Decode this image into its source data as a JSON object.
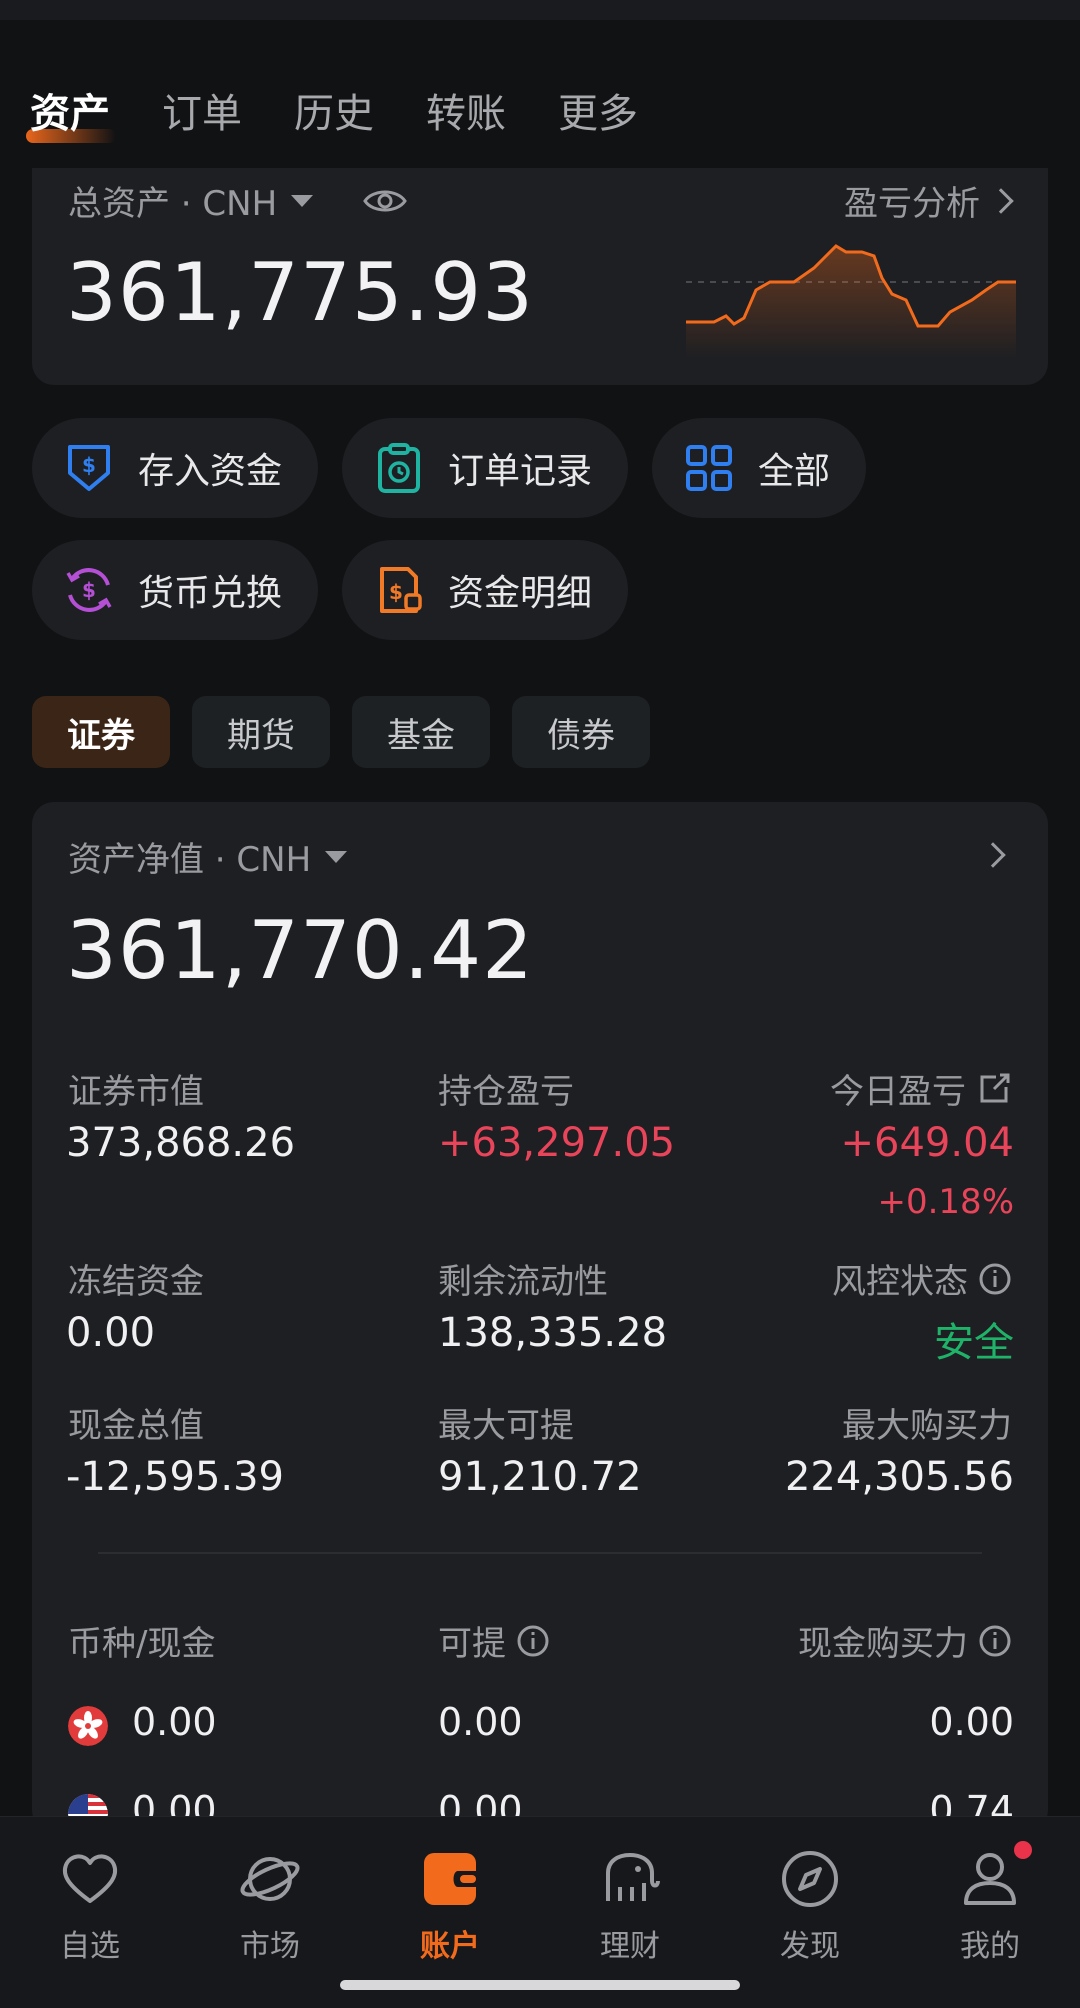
{
  "top_tabs": [
    "资产",
    "订单",
    "历史",
    "转账",
    "更多"
  ],
  "total": {
    "label": "总资产 · CNH",
    "value": "361,775.93",
    "pl_link": "盈亏分析"
  },
  "actions": [
    "存入资金",
    "订单记录",
    "全部",
    "货币兑换",
    "资金明细"
  ],
  "chips": [
    "证券",
    "期货",
    "基金",
    "债券"
  ],
  "net": {
    "label": "资产净值 · CNH",
    "value": "361,770.42",
    "metrics": {
      "market_value_label": "证券市值",
      "market_value": "373,868.26",
      "position_pl_label": "持仓盈亏",
      "position_pl": "+63,297.05",
      "today_pl_label": "今日盈亏",
      "today_pl": "+649.04",
      "today_pl_pct": "+0.18%",
      "frozen_label": "冻结资金",
      "frozen": "0.00",
      "liquidity_label": "剩余流动性",
      "liquidity": "138,335.28",
      "risk_label": "风控状态",
      "risk": "安全",
      "cash_total_label": "现金总值",
      "cash_total": "-12,595.39",
      "max_withdraw_label": "最大可提",
      "max_withdraw": "91,210.72",
      "max_buy_label": "最大购买力",
      "max_buy": "224,305.56"
    },
    "currency_table": {
      "headers": [
        "币种/现金",
        "可提",
        "现金购买力"
      ],
      "rows": [
        {
          "flag": "hk-flag-icon",
          "cash": "0.00",
          "withdraw": "0.00",
          "buying_power": "0.00"
        },
        {
          "flag": "us-flag-icon",
          "cash": "0.00",
          "withdraw": "0.00",
          "buying_power": "0.74"
        }
      ]
    }
  },
  "bottom_nav": [
    "自选",
    "市场",
    "账户",
    "理财",
    "发现",
    "我的"
  ],
  "colors": {
    "accent": "#f26b1d",
    "up": "#e8445a",
    "safe": "#1fb36a",
    "background": "#111214",
    "card": "#1e1f22"
  }
}
